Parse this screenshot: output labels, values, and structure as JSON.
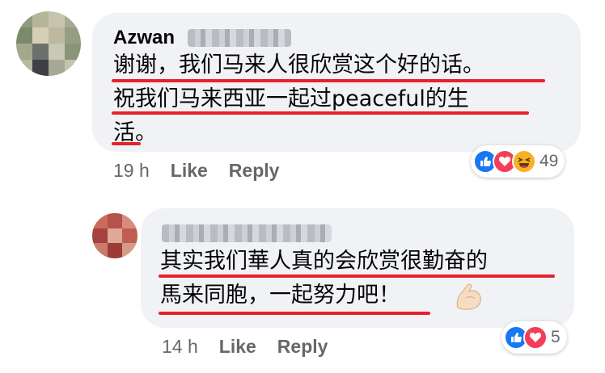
{
  "comments": [
    {
      "author": "Azwan",
      "lines": [
        "谢谢，我们马来人很欣赏这个好的话。",
        "祝我们马来西亚一起过peaceful的生",
        "活。"
      ],
      "reaction_count": "49",
      "reactions": [
        "like-icon",
        "love-icon",
        "haha-icon"
      ],
      "time": "19 h",
      "like_label": "Like",
      "reply_label": "Reply"
    },
    {
      "author": "",
      "lines": [
        "其实我们華人真的会欣赏很勤奋的",
        "馬来同胞，一起努力吧！"
      ],
      "reaction_count": "5",
      "reactions": [
        "like-icon",
        "love-icon"
      ],
      "emoji": "flexed-biceps-icon",
      "time": "14 h",
      "like_label": "Like",
      "reply_label": "Reply"
    }
  ],
  "colors": {
    "bubble": "#f0f2f5",
    "underline": "#e8202a",
    "like": "#1877f2",
    "love": "#f33e58",
    "haha": "#f7b125",
    "meta_text": "#65676b"
  }
}
